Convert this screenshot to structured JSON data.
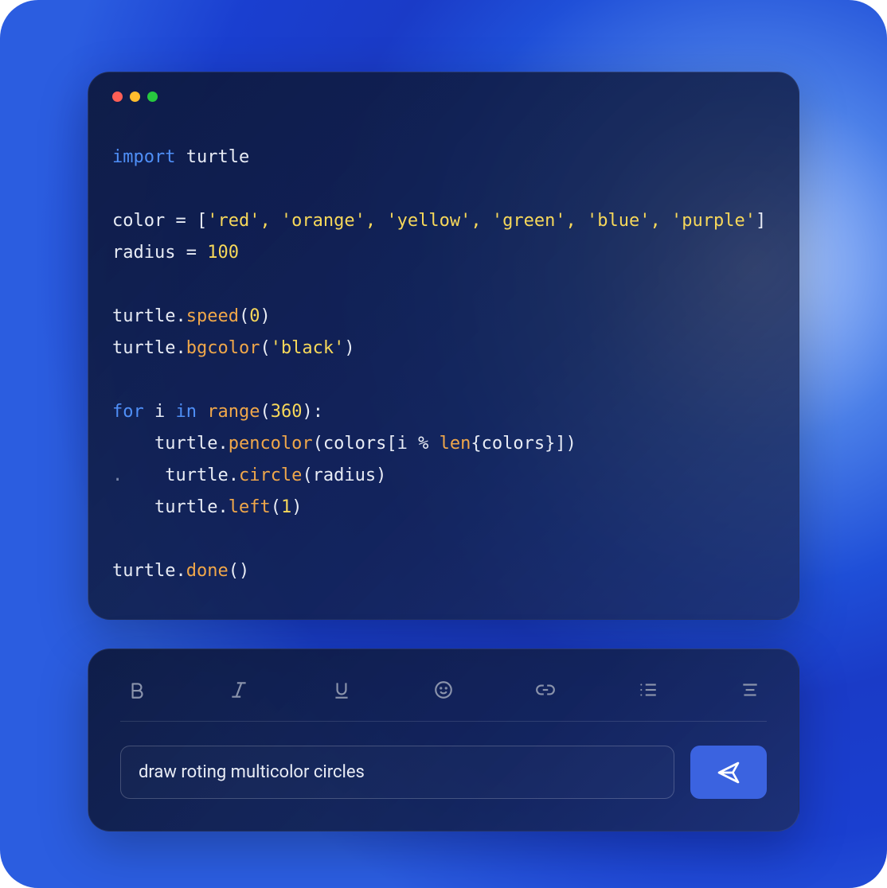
{
  "code": {
    "l1": {
      "kw": "import",
      "mod": " turtle"
    },
    "l2": {
      "a": "color = [",
      "s": "'red', 'orange', 'yellow', 'green', 'blue', 'purple'",
      "b": "]"
    },
    "l3": {
      "a": "radius = ",
      "n": "100"
    },
    "l4": {
      "a": "turtle.",
      "fn": "speed",
      "b": "(",
      "n": "0",
      "c": ")"
    },
    "l5": {
      "a": "turtle.",
      "fn": "bgcolor",
      "b": "(",
      "s": "'black'",
      "c": ")"
    },
    "l6": {
      "kw1": "for",
      "a": " i ",
      "kw2": "in",
      "b": " ",
      "fn": "range",
      "c": "(",
      "n": "360",
      "d": "):"
    },
    "l7": {
      "indent": "    turtle.",
      "fn": "pencolor",
      "a": "(colors[i % ",
      "bi": "len",
      "b": "{colors}])"
    },
    "l8": {
      "dot": ".",
      "indent": "    turtle.",
      "fn": "circle",
      "a": "(radius)"
    },
    "l9": {
      "indent": "    turtle.",
      "fn": "left",
      "a": "(",
      "n": "1",
      "b": ")"
    },
    "l10": {
      "a": "turtle.",
      "fn": "done",
      "b": "()"
    }
  },
  "input": {
    "value": "draw roting multicolor circles"
  },
  "icons": [
    "bold",
    "italic",
    "underline",
    "emoji",
    "link",
    "list",
    "align"
  ]
}
